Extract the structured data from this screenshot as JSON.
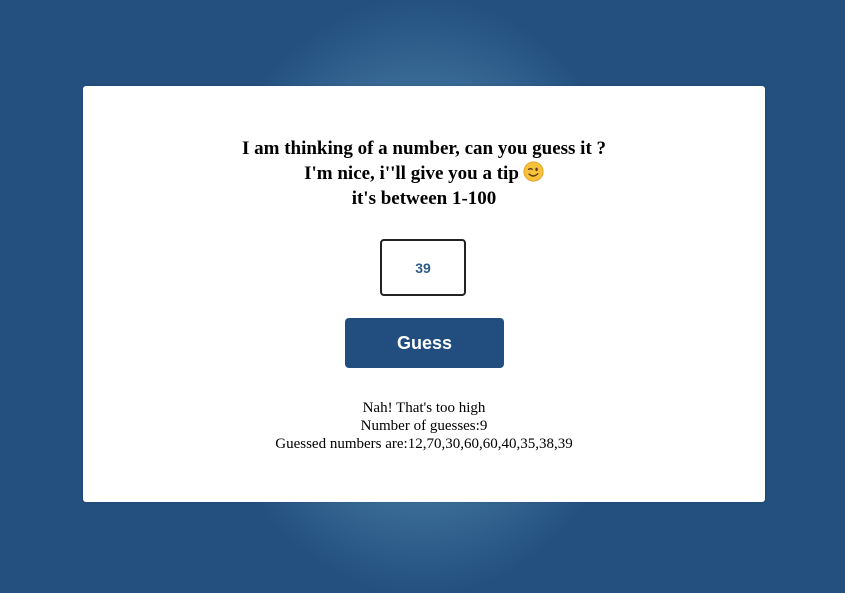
{
  "prompt": {
    "line1": "I am thinking of a number, can you guess it ?",
    "line2": "I'm nice, i''ll give you a tip",
    "line3": "it's between 1-100",
    "tip_icon": "winking-face-icon"
  },
  "guess_input": {
    "value": "39"
  },
  "guess_button": {
    "label": "Guess"
  },
  "results": {
    "feedback": "Nah! That's too high",
    "count_label": "Number of guesses:",
    "count": "9",
    "history_label": "Guessed numbers are:",
    "history": "12,70,30,60,60,40,35,38,39"
  },
  "colors": {
    "background": "#23507f",
    "card": "#ffffff",
    "button": "#214e7f",
    "input_text": "#2f5d85"
  }
}
